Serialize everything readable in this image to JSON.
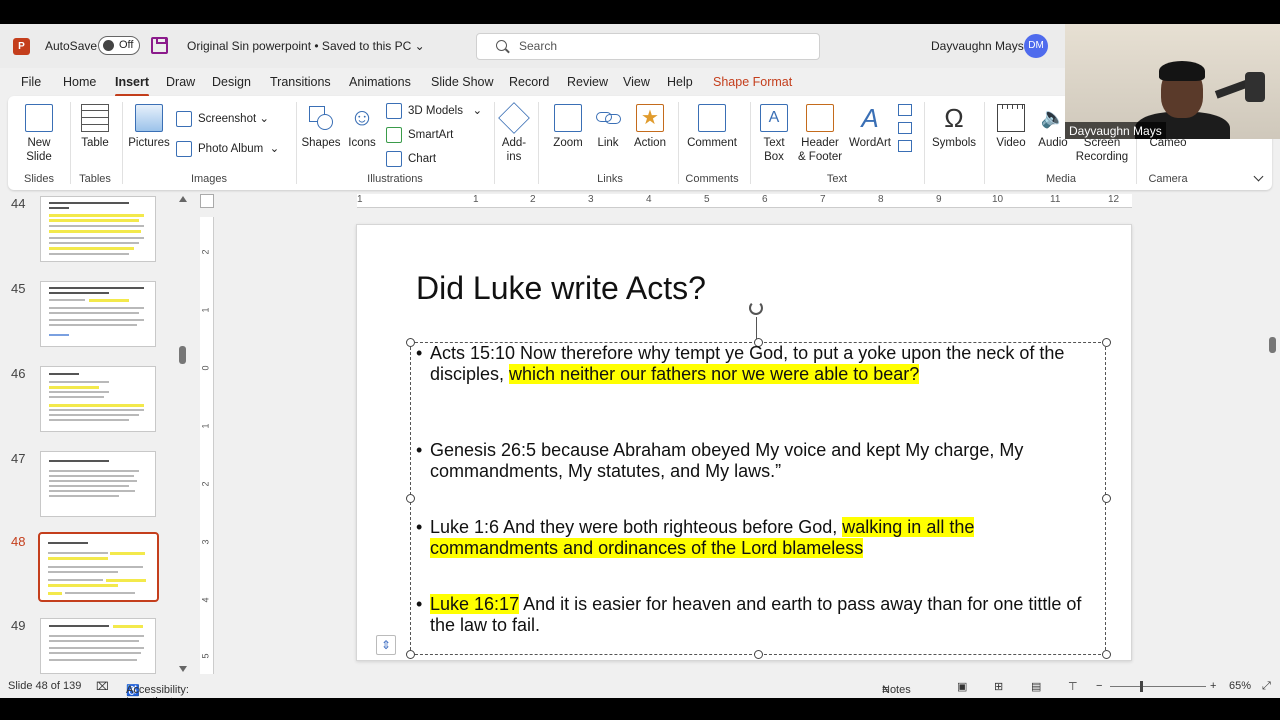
{
  "titlebar": {
    "app_icon": "P",
    "autosave_label": "AutoSave",
    "autosave_state": "Off",
    "document": "Original Sin powerpoint • Saved to this PC",
    "user_name": "Dayvaughn Mays",
    "user_initials": "DM"
  },
  "search": {
    "placeholder": "Search"
  },
  "tabs": [
    "File",
    "Home",
    "Insert",
    "Draw",
    "Design",
    "Transitions",
    "Animations",
    "Slide Show",
    "Record",
    "Review",
    "View",
    "Help",
    "Shape Format"
  ],
  "ribbon": {
    "new_slide": [
      "New",
      "Slide"
    ],
    "table": "Table",
    "pictures": "Pictures",
    "screenshot": "Screenshot",
    "photo_album": "Photo Album",
    "shapes": "Shapes",
    "icons": "Icons",
    "models_3d": "3D Models",
    "smartart": "SmartArt",
    "chart": "Chart",
    "addins": [
      "Add-",
      "ins"
    ],
    "zoom": "Zoom",
    "link": "Link",
    "action": "Action",
    "comment": "Comment",
    "textbox": [
      "Text",
      "Box"
    ],
    "header_footer": [
      "Header",
      "& Footer"
    ],
    "wordart": "WordArt",
    "symbols": "Symbols",
    "video": "Video",
    "audio": "Audio",
    "screen_recording": [
      "Screen",
      "Recording"
    ],
    "cameo": "Cameo",
    "groups": {
      "slides": "Slides",
      "tables": "Tables",
      "images": "Images",
      "illustrations": "Illustrations",
      "links": "Links",
      "comments": "Comments",
      "text": "Text",
      "media": "Media",
      "camera": "Camera"
    }
  },
  "thumbnails": [
    {
      "number": "44",
      "title": "The Romans did not care about Jewish laws"
    },
    {
      "number": "45",
      "title": "There is no teaching of needing a messiah for the resurrection of the dead."
    },
    {
      "number": "46",
      "title": "Resurrection"
    },
    {
      "number": "47",
      "title": "How do you get in the book?"
    },
    {
      "number": "48",
      "title": "Did Luke write Acts?"
    },
    {
      "number": "49",
      "title": "Is that loopol? the law, happy is he"
    }
  ],
  "ruler_h": [
    "1",
    "1",
    "2",
    "3",
    "4",
    "5",
    "6",
    "7",
    "8",
    "9",
    "10",
    "11",
    "12"
  ],
  "ruler_v": [
    "2",
    "1",
    "0",
    "1",
    "2",
    "3",
    "4",
    "5"
  ],
  "slide": {
    "title": "Did Luke write Acts?",
    "bullets": [
      {
        "plain": "Acts 15:10 Now therefore why tempt ye God, to put a yoke upon the neck of the disciples, ",
        "highlight": "which neither our fathers nor we were able to bear?",
        "rest": ""
      },
      {
        "plain": "Genesis 26:5 because Abraham obeyed My voice and kept My charge, My commandments, My statutes, and My laws.”",
        "highlight": "",
        "rest": ""
      },
      {
        "plain": "Luke 1:6 And they were both righteous before God, ",
        "highlight": "walking in all the commandments and ordinances of the Lord blameless",
        "rest": ""
      },
      {
        "lead_highlight": "Luke 16:17",
        "plain": " And it is easier for heaven and earth to pass away than for one tittle of the law to fail."
      }
    ]
  },
  "status": {
    "slide_info": "Slide 48 of 139",
    "accessibility": "Accessibility: Investigate",
    "notes": "Notes",
    "zoom": "65%",
    "minus": "−",
    "plus": "+"
  },
  "camera": {
    "name": "Dayvaughn Mays"
  },
  "colors": {
    "accent": "#c43e1c",
    "highlight": "#ffff00"
  }
}
